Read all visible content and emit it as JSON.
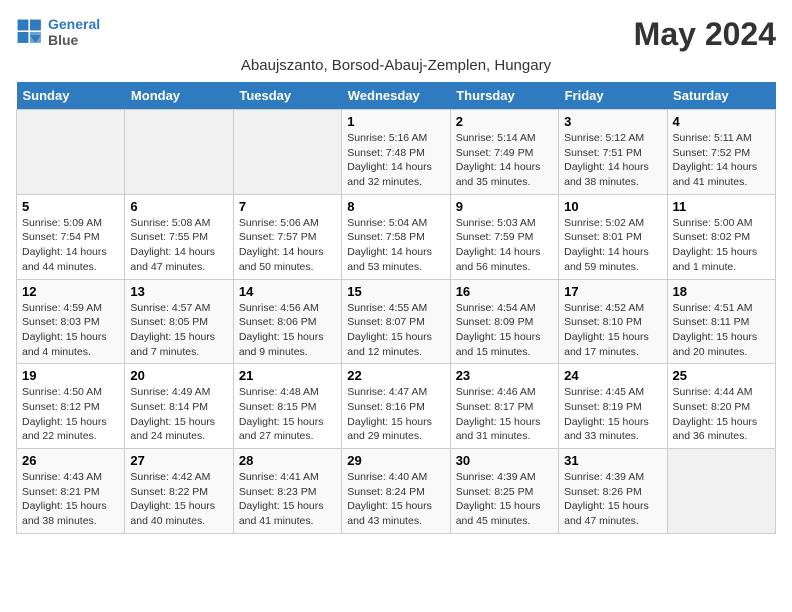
{
  "header": {
    "logo_line1": "General",
    "logo_line2": "Blue",
    "title": "May 2024",
    "subtitle": "Abaujszanto, Borsod-Abauj-Zemplen, Hungary"
  },
  "days_of_week": [
    "Sunday",
    "Monday",
    "Tuesday",
    "Wednesday",
    "Thursday",
    "Friday",
    "Saturday"
  ],
  "weeks": [
    [
      {
        "day": "",
        "info": ""
      },
      {
        "day": "",
        "info": ""
      },
      {
        "day": "",
        "info": ""
      },
      {
        "day": "1",
        "info": "Sunrise: 5:16 AM\nSunset: 7:48 PM\nDaylight: 14 hours and 32 minutes."
      },
      {
        "day": "2",
        "info": "Sunrise: 5:14 AM\nSunset: 7:49 PM\nDaylight: 14 hours and 35 minutes."
      },
      {
        "day": "3",
        "info": "Sunrise: 5:12 AM\nSunset: 7:51 PM\nDaylight: 14 hours and 38 minutes."
      },
      {
        "day": "4",
        "info": "Sunrise: 5:11 AM\nSunset: 7:52 PM\nDaylight: 14 hours and 41 minutes."
      }
    ],
    [
      {
        "day": "5",
        "info": "Sunrise: 5:09 AM\nSunset: 7:54 PM\nDaylight: 14 hours and 44 minutes."
      },
      {
        "day": "6",
        "info": "Sunrise: 5:08 AM\nSunset: 7:55 PM\nDaylight: 14 hours and 47 minutes."
      },
      {
        "day": "7",
        "info": "Sunrise: 5:06 AM\nSunset: 7:57 PM\nDaylight: 14 hours and 50 minutes."
      },
      {
        "day": "8",
        "info": "Sunrise: 5:04 AM\nSunset: 7:58 PM\nDaylight: 14 hours and 53 minutes."
      },
      {
        "day": "9",
        "info": "Sunrise: 5:03 AM\nSunset: 7:59 PM\nDaylight: 14 hours and 56 minutes."
      },
      {
        "day": "10",
        "info": "Sunrise: 5:02 AM\nSunset: 8:01 PM\nDaylight: 14 hours and 59 minutes."
      },
      {
        "day": "11",
        "info": "Sunrise: 5:00 AM\nSunset: 8:02 PM\nDaylight: 15 hours and 1 minute."
      }
    ],
    [
      {
        "day": "12",
        "info": "Sunrise: 4:59 AM\nSunset: 8:03 PM\nDaylight: 15 hours and 4 minutes."
      },
      {
        "day": "13",
        "info": "Sunrise: 4:57 AM\nSunset: 8:05 PM\nDaylight: 15 hours and 7 minutes."
      },
      {
        "day": "14",
        "info": "Sunrise: 4:56 AM\nSunset: 8:06 PM\nDaylight: 15 hours and 9 minutes."
      },
      {
        "day": "15",
        "info": "Sunrise: 4:55 AM\nSunset: 8:07 PM\nDaylight: 15 hours and 12 minutes."
      },
      {
        "day": "16",
        "info": "Sunrise: 4:54 AM\nSunset: 8:09 PM\nDaylight: 15 hours and 15 minutes."
      },
      {
        "day": "17",
        "info": "Sunrise: 4:52 AM\nSunset: 8:10 PM\nDaylight: 15 hours and 17 minutes."
      },
      {
        "day": "18",
        "info": "Sunrise: 4:51 AM\nSunset: 8:11 PM\nDaylight: 15 hours and 20 minutes."
      }
    ],
    [
      {
        "day": "19",
        "info": "Sunrise: 4:50 AM\nSunset: 8:12 PM\nDaylight: 15 hours and 22 minutes."
      },
      {
        "day": "20",
        "info": "Sunrise: 4:49 AM\nSunset: 8:14 PM\nDaylight: 15 hours and 24 minutes."
      },
      {
        "day": "21",
        "info": "Sunrise: 4:48 AM\nSunset: 8:15 PM\nDaylight: 15 hours and 27 minutes."
      },
      {
        "day": "22",
        "info": "Sunrise: 4:47 AM\nSunset: 8:16 PM\nDaylight: 15 hours and 29 minutes."
      },
      {
        "day": "23",
        "info": "Sunrise: 4:46 AM\nSunset: 8:17 PM\nDaylight: 15 hours and 31 minutes."
      },
      {
        "day": "24",
        "info": "Sunrise: 4:45 AM\nSunset: 8:19 PM\nDaylight: 15 hours and 33 minutes."
      },
      {
        "day": "25",
        "info": "Sunrise: 4:44 AM\nSunset: 8:20 PM\nDaylight: 15 hours and 36 minutes."
      }
    ],
    [
      {
        "day": "26",
        "info": "Sunrise: 4:43 AM\nSunset: 8:21 PM\nDaylight: 15 hours and 38 minutes."
      },
      {
        "day": "27",
        "info": "Sunrise: 4:42 AM\nSunset: 8:22 PM\nDaylight: 15 hours and 40 minutes."
      },
      {
        "day": "28",
        "info": "Sunrise: 4:41 AM\nSunset: 8:23 PM\nDaylight: 15 hours and 41 minutes."
      },
      {
        "day": "29",
        "info": "Sunrise: 4:40 AM\nSunset: 8:24 PM\nDaylight: 15 hours and 43 minutes."
      },
      {
        "day": "30",
        "info": "Sunrise: 4:39 AM\nSunset: 8:25 PM\nDaylight: 15 hours and 45 minutes."
      },
      {
        "day": "31",
        "info": "Sunrise: 4:39 AM\nSunset: 8:26 PM\nDaylight: 15 hours and 47 minutes."
      },
      {
        "day": "",
        "info": ""
      }
    ]
  ]
}
